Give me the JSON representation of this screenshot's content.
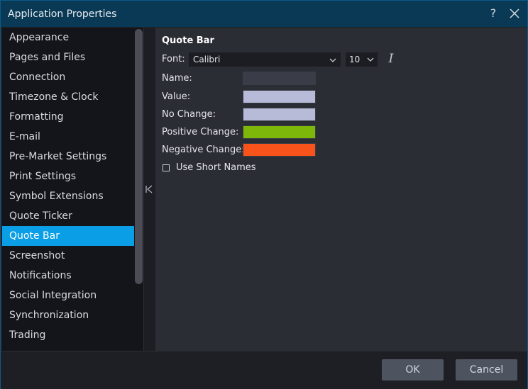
{
  "window": {
    "title": "Application Properties",
    "help_icon": "question-mark-icon",
    "close_icon": "close-x-icon"
  },
  "sidebar": {
    "items": [
      {
        "label": "Appearance",
        "active": false
      },
      {
        "label": "Pages and Files",
        "active": false
      },
      {
        "label": "Connection",
        "active": false
      },
      {
        "label": "Timezone & Clock",
        "active": false
      },
      {
        "label": "Formatting",
        "active": false
      },
      {
        "label": "E-mail",
        "active": false
      },
      {
        "label": "Pre-Market Settings",
        "active": false
      },
      {
        "label": "Print Settings",
        "active": false
      },
      {
        "label": "Symbol Extensions",
        "active": false
      },
      {
        "label": "Quote Ticker",
        "active": false
      },
      {
        "label": "Quote Bar",
        "active": true
      },
      {
        "label": "Screenshot",
        "active": false
      },
      {
        "label": "Notifications",
        "active": false
      },
      {
        "label": "Social Integration",
        "active": false
      },
      {
        "label": "Synchronization",
        "active": false
      },
      {
        "label": "Trading",
        "active": false
      }
    ],
    "active_color": "#0a9ee6"
  },
  "main": {
    "section_title": "Quote Bar",
    "font": {
      "label": "Font:",
      "value": "Calibri",
      "size": "10",
      "italic_icon": "italic-icon"
    },
    "colors": [
      {
        "label": "Name:",
        "color": "#3a3d48"
      },
      {
        "label": "Value:",
        "color": "#b7bbd8"
      },
      {
        "label": "No Change:",
        "color": "#b7bbd8"
      },
      {
        "label": "Positive Change:",
        "color": "#7db70a"
      },
      {
        "label": "Negative Change:",
        "color": "#f7531a"
      }
    ],
    "use_short_names": {
      "label": "Use Short Names",
      "checked": false
    }
  },
  "footer": {
    "ok_label": "OK",
    "cancel_label": "Cancel"
  }
}
